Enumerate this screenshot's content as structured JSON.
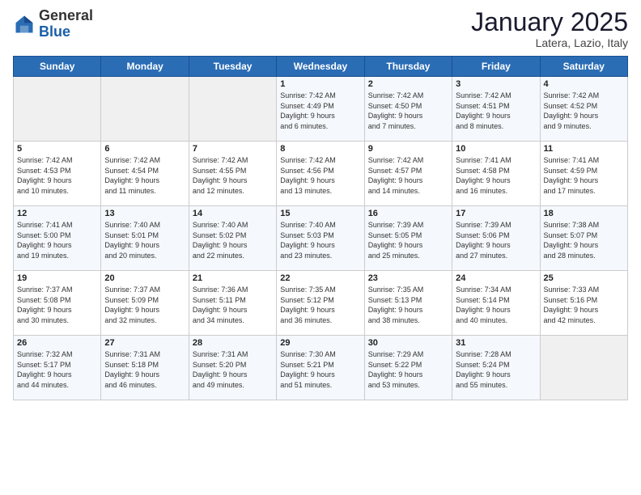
{
  "header": {
    "logo_general": "General",
    "logo_blue": "Blue",
    "calendar_title": "January 2025",
    "calendar_subtitle": "Latera, Lazio, Italy"
  },
  "weekdays": [
    "Sunday",
    "Monday",
    "Tuesday",
    "Wednesday",
    "Thursday",
    "Friday",
    "Saturday"
  ],
  "weeks": [
    [
      {
        "day": "",
        "info": ""
      },
      {
        "day": "",
        "info": ""
      },
      {
        "day": "",
        "info": ""
      },
      {
        "day": "1",
        "info": "Sunrise: 7:42 AM\nSunset: 4:49 PM\nDaylight: 9 hours\nand 6 minutes."
      },
      {
        "day": "2",
        "info": "Sunrise: 7:42 AM\nSunset: 4:50 PM\nDaylight: 9 hours\nand 7 minutes."
      },
      {
        "day": "3",
        "info": "Sunrise: 7:42 AM\nSunset: 4:51 PM\nDaylight: 9 hours\nand 8 minutes."
      },
      {
        "day": "4",
        "info": "Sunrise: 7:42 AM\nSunset: 4:52 PM\nDaylight: 9 hours\nand 9 minutes."
      }
    ],
    [
      {
        "day": "5",
        "info": "Sunrise: 7:42 AM\nSunset: 4:53 PM\nDaylight: 9 hours\nand 10 minutes."
      },
      {
        "day": "6",
        "info": "Sunrise: 7:42 AM\nSunset: 4:54 PM\nDaylight: 9 hours\nand 11 minutes."
      },
      {
        "day": "7",
        "info": "Sunrise: 7:42 AM\nSunset: 4:55 PM\nDaylight: 9 hours\nand 12 minutes."
      },
      {
        "day": "8",
        "info": "Sunrise: 7:42 AM\nSunset: 4:56 PM\nDaylight: 9 hours\nand 13 minutes."
      },
      {
        "day": "9",
        "info": "Sunrise: 7:42 AM\nSunset: 4:57 PM\nDaylight: 9 hours\nand 14 minutes."
      },
      {
        "day": "10",
        "info": "Sunrise: 7:41 AM\nSunset: 4:58 PM\nDaylight: 9 hours\nand 16 minutes."
      },
      {
        "day": "11",
        "info": "Sunrise: 7:41 AM\nSunset: 4:59 PM\nDaylight: 9 hours\nand 17 minutes."
      }
    ],
    [
      {
        "day": "12",
        "info": "Sunrise: 7:41 AM\nSunset: 5:00 PM\nDaylight: 9 hours\nand 19 minutes."
      },
      {
        "day": "13",
        "info": "Sunrise: 7:40 AM\nSunset: 5:01 PM\nDaylight: 9 hours\nand 20 minutes."
      },
      {
        "day": "14",
        "info": "Sunrise: 7:40 AM\nSunset: 5:02 PM\nDaylight: 9 hours\nand 22 minutes."
      },
      {
        "day": "15",
        "info": "Sunrise: 7:40 AM\nSunset: 5:03 PM\nDaylight: 9 hours\nand 23 minutes."
      },
      {
        "day": "16",
        "info": "Sunrise: 7:39 AM\nSunset: 5:05 PM\nDaylight: 9 hours\nand 25 minutes."
      },
      {
        "day": "17",
        "info": "Sunrise: 7:39 AM\nSunset: 5:06 PM\nDaylight: 9 hours\nand 27 minutes."
      },
      {
        "day": "18",
        "info": "Sunrise: 7:38 AM\nSunset: 5:07 PM\nDaylight: 9 hours\nand 28 minutes."
      }
    ],
    [
      {
        "day": "19",
        "info": "Sunrise: 7:37 AM\nSunset: 5:08 PM\nDaylight: 9 hours\nand 30 minutes."
      },
      {
        "day": "20",
        "info": "Sunrise: 7:37 AM\nSunset: 5:09 PM\nDaylight: 9 hours\nand 32 minutes."
      },
      {
        "day": "21",
        "info": "Sunrise: 7:36 AM\nSunset: 5:11 PM\nDaylight: 9 hours\nand 34 minutes."
      },
      {
        "day": "22",
        "info": "Sunrise: 7:35 AM\nSunset: 5:12 PM\nDaylight: 9 hours\nand 36 minutes."
      },
      {
        "day": "23",
        "info": "Sunrise: 7:35 AM\nSunset: 5:13 PM\nDaylight: 9 hours\nand 38 minutes."
      },
      {
        "day": "24",
        "info": "Sunrise: 7:34 AM\nSunset: 5:14 PM\nDaylight: 9 hours\nand 40 minutes."
      },
      {
        "day": "25",
        "info": "Sunrise: 7:33 AM\nSunset: 5:16 PM\nDaylight: 9 hours\nand 42 minutes."
      }
    ],
    [
      {
        "day": "26",
        "info": "Sunrise: 7:32 AM\nSunset: 5:17 PM\nDaylight: 9 hours\nand 44 minutes."
      },
      {
        "day": "27",
        "info": "Sunrise: 7:31 AM\nSunset: 5:18 PM\nDaylight: 9 hours\nand 46 minutes."
      },
      {
        "day": "28",
        "info": "Sunrise: 7:31 AM\nSunset: 5:20 PM\nDaylight: 9 hours\nand 49 minutes."
      },
      {
        "day": "29",
        "info": "Sunrise: 7:30 AM\nSunset: 5:21 PM\nDaylight: 9 hours\nand 51 minutes."
      },
      {
        "day": "30",
        "info": "Sunrise: 7:29 AM\nSunset: 5:22 PM\nDaylight: 9 hours\nand 53 minutes."
      },
      {
        "day": "31",
        "info": "Sunrise: 7:28 AM\nSunset: 5:24 PM\nDaylight: 9 hours\nand 55 minutes."
      },
      {
        "day": "",
        "info": ""
      }
    ]
  ]
}
